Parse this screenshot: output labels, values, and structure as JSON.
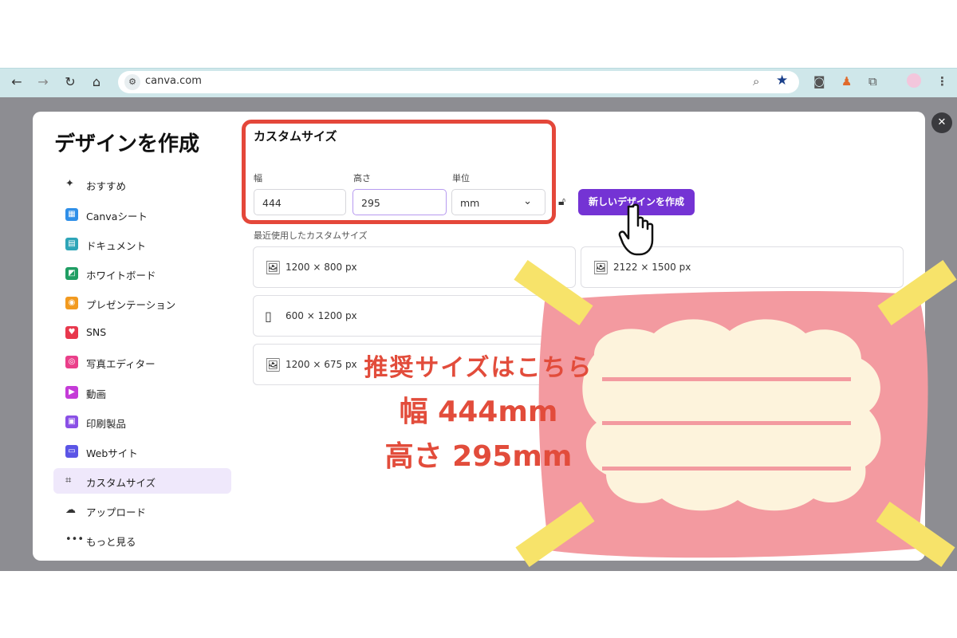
{
  "browser": {
    "url": "canva.com",
    "icons": [
      "back-icon",
      "forward-icon",
      "reload-icon",
      "home-icon",
      "site-settings-icon",
      "zoom-icon",
      "star-icon",
      "camera-icon",
      "extension-icon",
      "puzzle-icon",
      "profile-icon",
      "menu-icon"
    ],
    "accent": "#cfe7ea"
  },
  "modal": {
    "title": "デザインを作成",
    "close_icon": "close-icon"
  },
  "sidebar": {
    "items": [
      {
        "label": "おすすめ",
        "icon": "sparkle-icon",
        "color": "#333333"
      },
      {
        "label": "Canvaシート",
        "icon": "sheet-icon",
        "color": "#2f8fe8"
      },
      {
        "label": "ドキュメント",
        "icon": "doc-icon",
        "color": "#2ea5b8"
      },
      {
        "label": "ホワイトボード",
        "icon": "whiteboard-icon",
        "color": "#1f9e63"
      },
      {
        "label": "プレゼンテーション",
        "icon": "presentation-icon",
        "color": "#f29a1f"
      },
      {
        "label": "SNS",
        "icon": "heart-icon",
        "color": "#e8384d"
      },
      {
        "label": "写真エディター",
        "icon": "camera-icon",
        "color": "#ea3f8a"
      },
      {
        "label": "動画",
        "icon": "video-icon",
        "color": "#c53bd8"
      },
      {
        "label": "印刷製品",
        "icon": "print-icon",
        "color": "#8a50e6"
      },
      {
        "label": "Webサイト",
        "icon": "web-icon",
        "color": "#5b55e6"
      },
      {
        "label": "カスタムサイズ",
        "icon": "crop-icon",
        "color": "#333333",
        "active": true
      },
      {
        "label": "アップロード",
        "icon": "upload-cloud-icon",
        "color": "#333333"
      },
      {
        "label": "もっと見る",
        "icon": "more-dots-icon",
        "color": "#333333"
      }
    ]
  },
  "custom_size": {
    "title": "カスタムサイズ",
    "width_label": "幅",
    "width_value": "444",
    "height_label": "高さ",
    "height_value": "295",
    "unit_label": "単位",
    "unit_value": "mm",
    "create_button": "新しいデザインを作成",
    "recent_label": "最近使用したカスタムサイズ",
    "recent": [
      "1200 × 800 px",
      "2122 × 1500 px",
      "600 × 1200 px",
      "1200 × 675 px"
    ],
    "accent_color": "#7433d4"
  },
  "annotation": {
    "line1": "推奨サイズはこちら",
    "line2": "幅 444mm",
    "line3": "高さ 295mm",
    "highlight_color": "#e4473a",
    "note_bg": "#f39aa0",
    "cloud_color": "#fdf3dc",
    "tape_color": "#f7e36a"
  }
}
